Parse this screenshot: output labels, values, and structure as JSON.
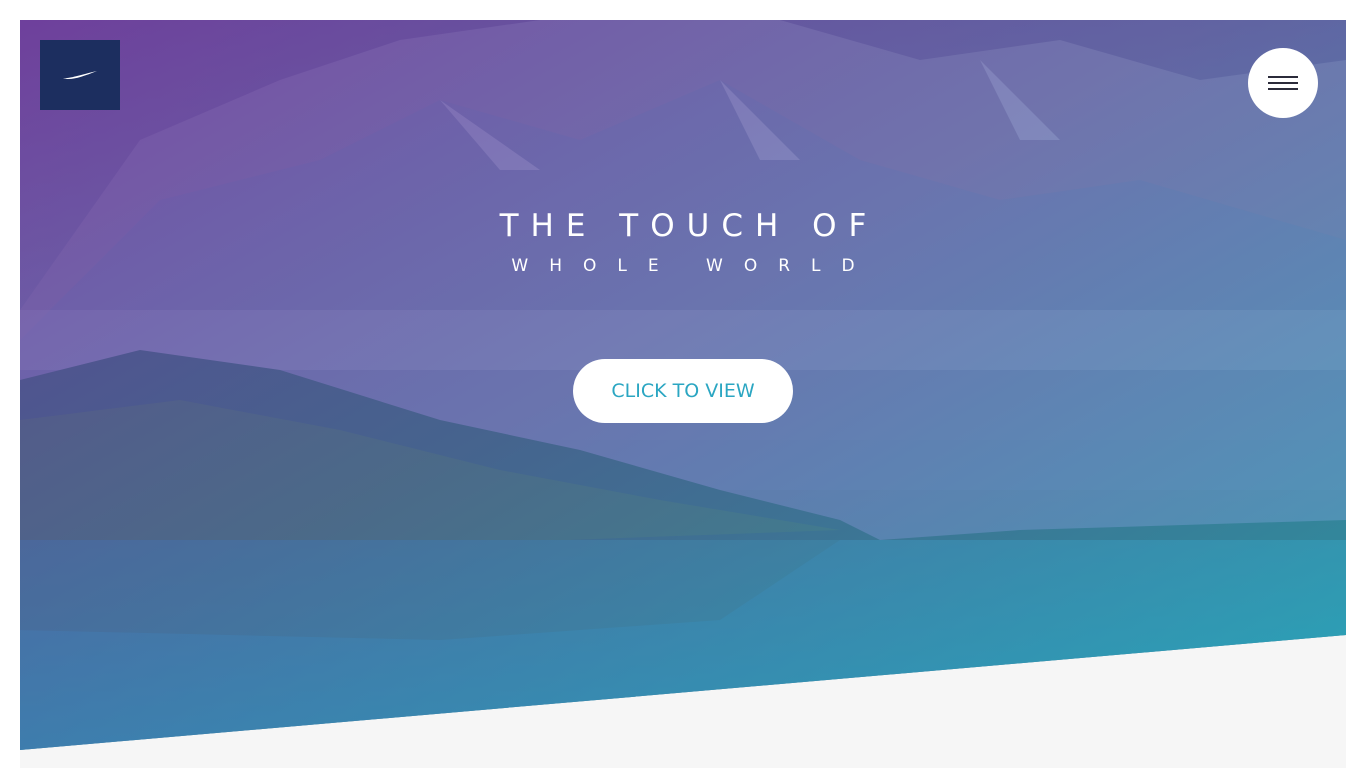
{
  "hero": {
    "title": "THE TOUCH OF",
    "subtitle": "WHOLE WORLD",
    "cta_label": "CLICK TO VIEW"
  },
  "logo": {
    "icon": "swoosh-logo-icon"
  },
  "menu": {
    "icon": "hamburger-menu-icon"
  },
  "colors": {
    "logo_bg": "#1c2e5f",
    "cta_text": "#2ba6c2",
    "page_bg": "#f6f6f6",
    "overlay_top": "#6a3f9a",
    "overlay_bottom": "#2aa3b8"
  }
}
